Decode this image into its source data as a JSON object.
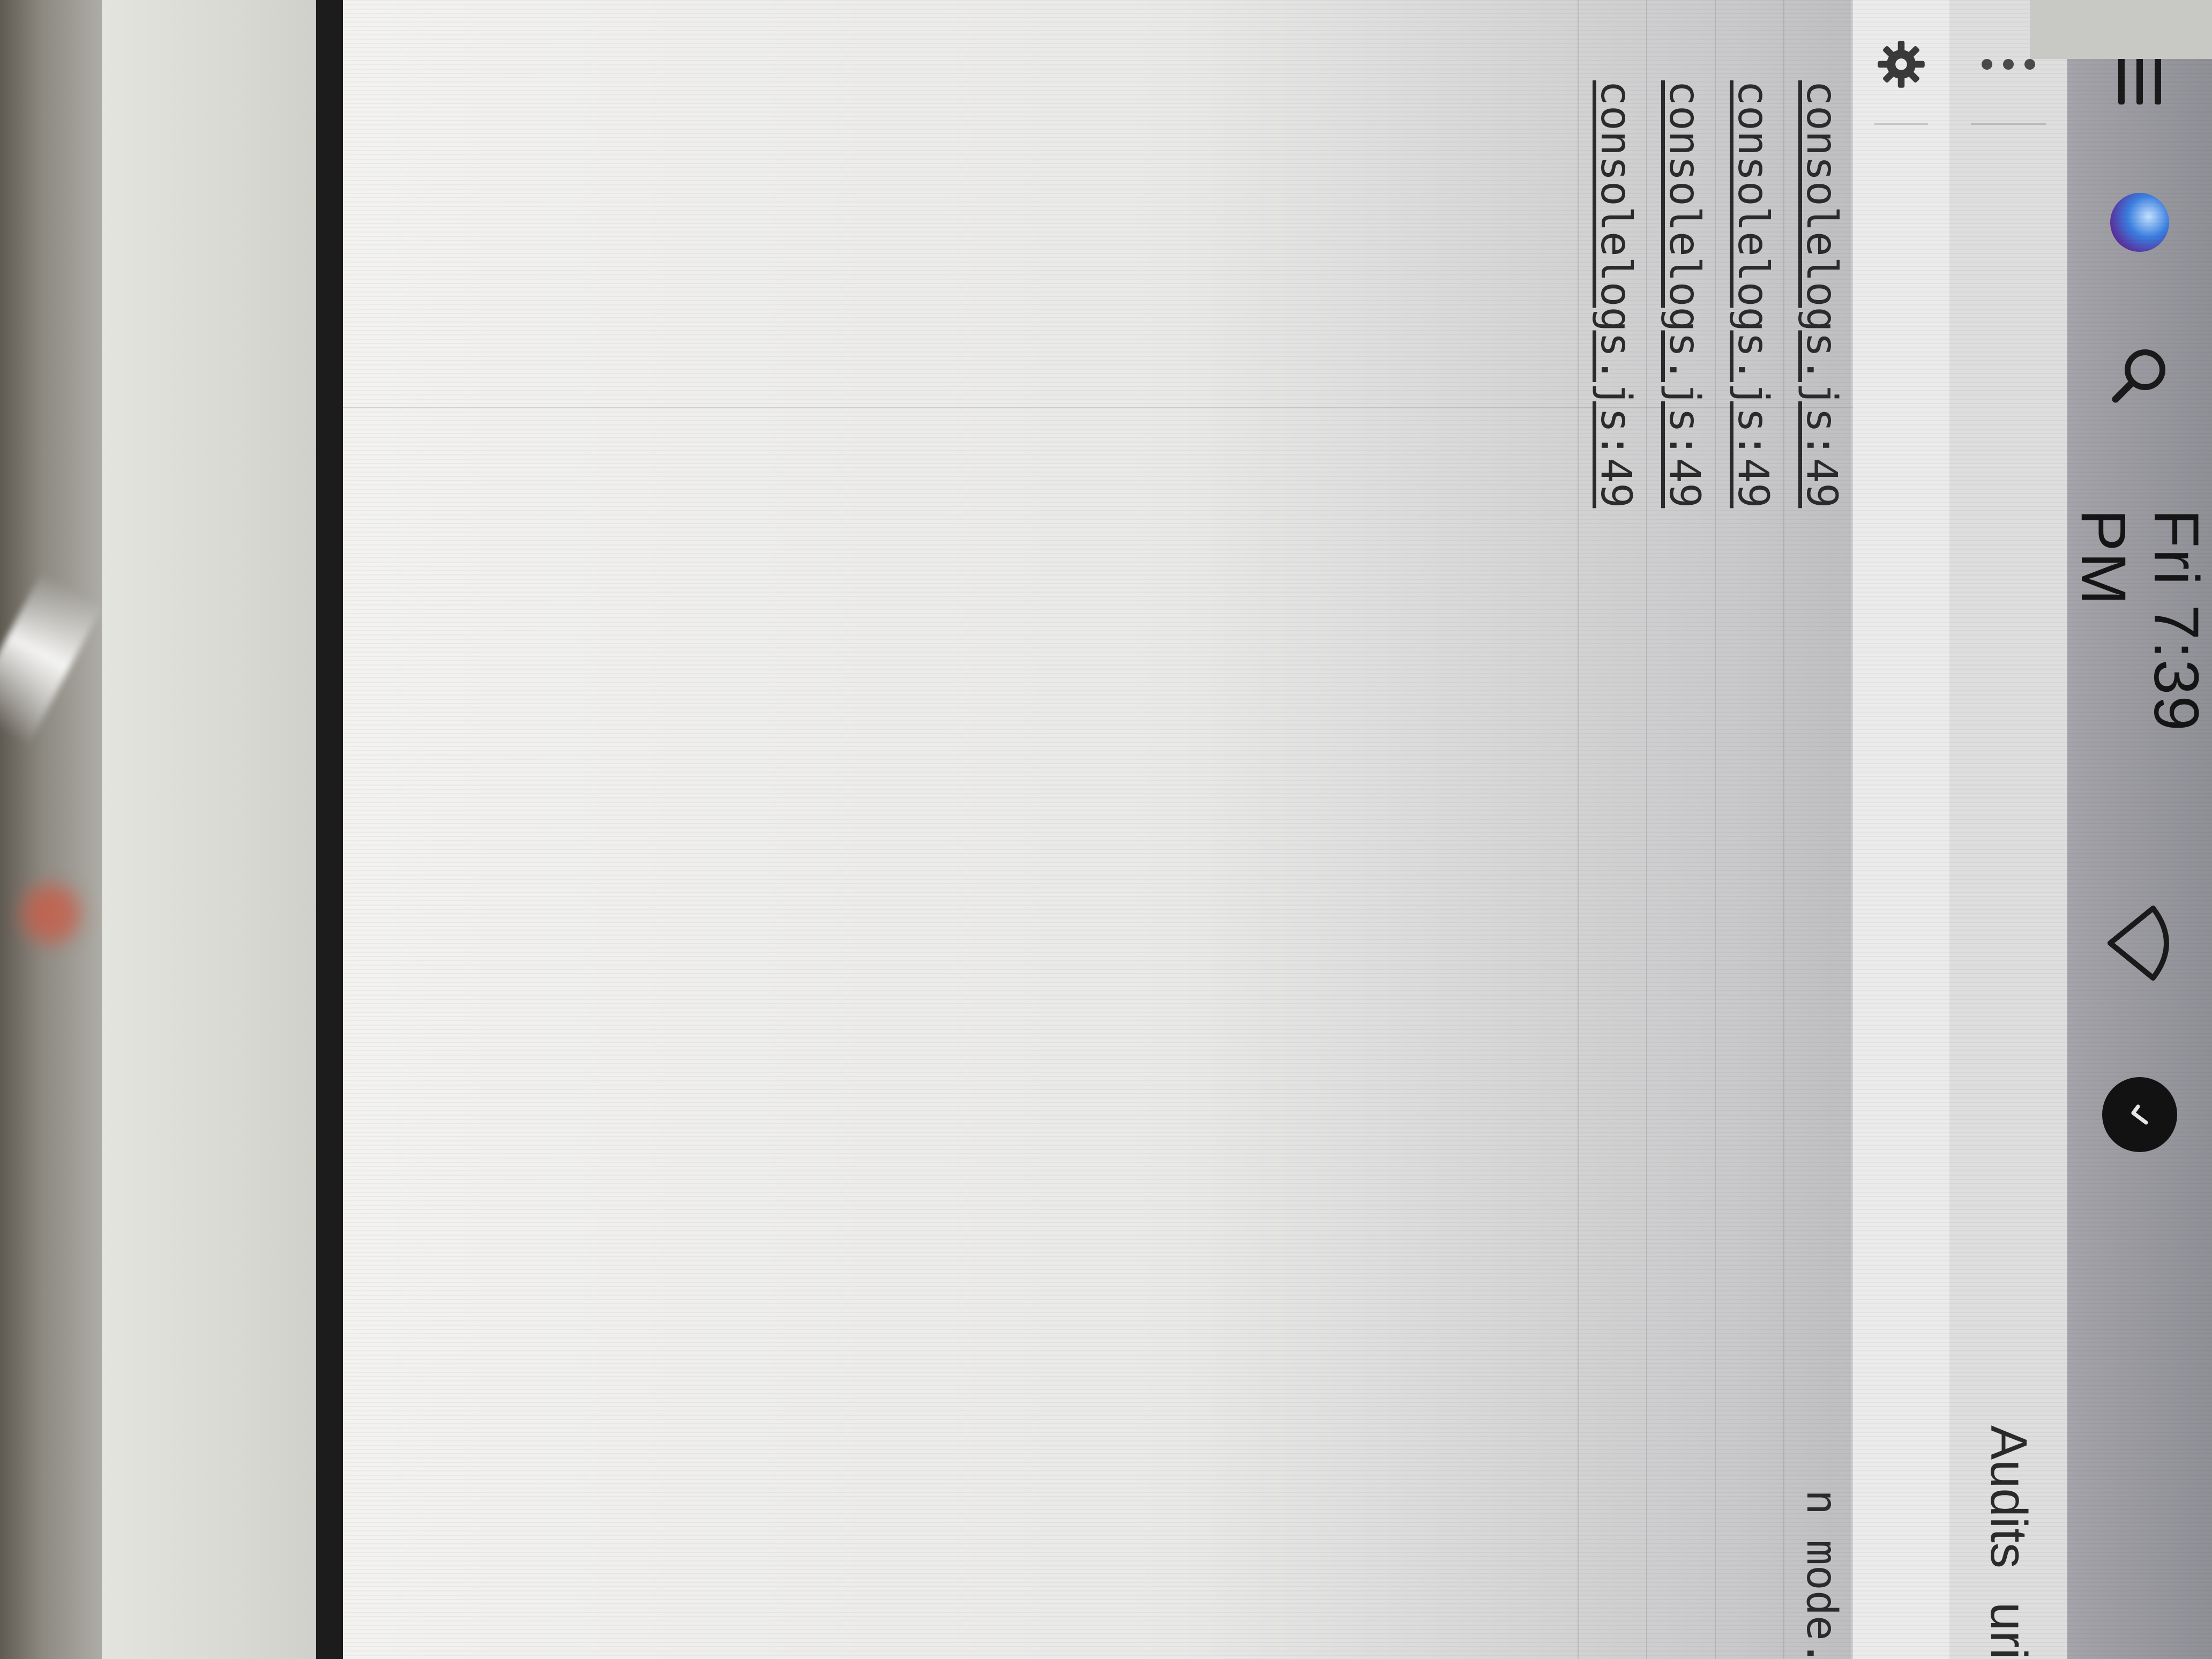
{
  "menubar": {
    "clock": "Fri 7:39 PM",
    "icons": [
      "hamburger-menu-icon",
      "siri-icon",
      "spotlight-search-icon",
      "wifi-icon",
      "app-status-icon"
    ]
  },
  "devtools": {
    "tabs": [
      {
        "label": "Audits"
      },
      {
        "label": "urity"
      }
    ]
  },
  "console": {
    "message_fragment": "n mode.",
    "rows": [
      {
        "source": "consolelogs.js:49"
      },
      {
        "source": "consolelogs.js:49"
      },
      {
        "source": "consolelogs.js:49"
      },
      {
        "source": "consolelogs.js:49"
      }
    ]
  },
  "colors": {
    "menubar": "#9a9aa0",
    "toolbar": "#dedede",
    "console_bg": "#efefee",
    "bezel": "#1c1c1c"
  }
}
